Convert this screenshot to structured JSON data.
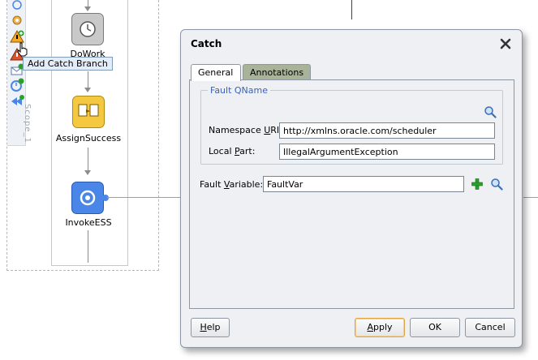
{
  "canvas": {
    "scope_label": "Scope_1",
    "tooltip": "Add Catch Branch",
    "nodes": {
      "do_work": "DoWork",
      "assign_success": "AssignSuccess",
      "invoke_ess": "InvokeESS"
    }
  },
  "dialog": {
    "title": "Catch",
    "tabs": {
      "general": "General",
      "annotations": "Annotations"
    },
    "fault_qname": {
      "legend": "Fault QName",
      "namespace_label_pre": "Namespace ",
      "namespace_label_u": "U",
      "namespace_label_post": "RI:",
      "namespace_value": "http://xmlns.oracle.com/scheduler",
      "local_label_pre": "Local ",
      "local_label_u": "P",
      "local_label_post": "art:",
      "local_value": "IllegalArgumentException"
    },
    "fault_variable": {
      "label_pre": "Fault ",
      "label_u": "V",
      "label_post": "ariable:",
      "value": "FaultVar"
    },
    "buttons": {
      "help_u": "H",
      "help_rest": "elp",
      "apply_u": "A",
      "apply_rest": "pply",
      "ok": "OK",
      "cancel": "Cancel"
    }
  },
  "colors": {
    "legend": "#3a62b8",
    "annotations_tab": "#a9b39a",
    "assign_node": "#f5c842",
    "invoke_node": "#4a86e8"
  }
}
